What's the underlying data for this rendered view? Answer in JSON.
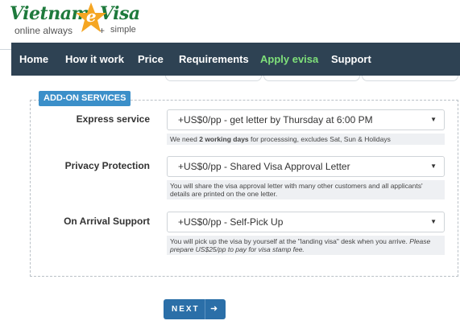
{
  "logo": {
    "word1": "Vietnam",
    "word_e": "e",
    "word2": "Visa",
    "tagline_left": "online always",
    "tagline_mid": "+",
    "tagline_right": "simple"
  },
  "nav": {
    "items": [
      {
        "label": "Home"
      },
      {
        "label": "How it work"
      },
      {
        "label": "Price"
      },
      {
        "label": "Requirements"
      },
      {
        "label": "Apply evisa"
      },
      {
        "label": "Support"
      }
    ],
    "active_item": "Apply evisa"
  },
  "addons": {
    "legend": "ADD-ON SERVICES",
    "express": {
      "label": "Express service",
      "value": "+US$0/pp - get letter by Thursday at 6:00 PM",
      "note_pre": "We need ",
      "note_bold": "2 working days",
      "note_post": " for processsing, excludes Sat, Sun & Holidays"
    },
    "privacy": {
      "label": "Privacy Protection",
      "value": "+US$0/pp - Shared Visa Approval Letter",
      "note": "You will share the visa approval letter with many other customers and all applicants' details are printed on the one letter."
    },
    "arrival": {
      "label": "On Arrival Support",
      "value": "+US$0/pp - Self-Pick Up",
      "note_pre": "You will pick up the visa by yourself at the \"landing visa\" desk when you arrive. ",
      "note_italic": "Please prepare US$25/pp to pay for visa stamp fee."
    }
  },
  "next_button": {
    "label": "NEXT",
    "arrow_icon": "arrow-right-icon"
  },
  "colors": {
    "nav_bg": "#2e4253",
    "nav_active": "#7fe07a",
    "legend_bg": "#3b8fc9",
    "button_bg": "#2b6fa8",
    "logo_green": "#1e7a3c",
    "logo_star": "#f5a623"
  }
}
